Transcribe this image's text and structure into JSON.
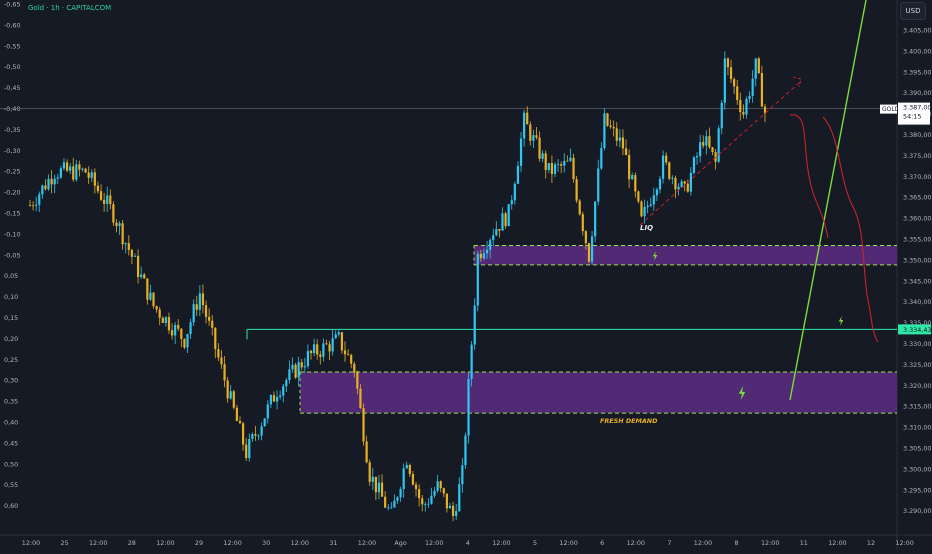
{
  "header": {
    "title": "Gold · 1h · CAPITALCOM",
    "currency": "USD"
  },
  "price_tag": {
    "symbol": "GOLD",
    "price": "3.387,00",
    "countdown": "54:15"
  },
  "level_tag": {
    "value": "3.334,43"
  },
  "annotations": {
    "liq": "LIQ",
    "fresh_demand": "FRESH DEMAND"
  },
  "colors": {
    "background": "#161a25",
    "bull_candle": "#2ec7f2",
    "bear_candle": "#e8b020",
    "demand_zone": "#5c2d83",
    "zone_border": "#9be24a",
    "level_line": "#2ee8a8",
    "projection_green": "#7cdd3a",
    "projection_red": "#d3242c"
  },
  "chart_data": {
    "type": "candlestick",
    "title": "Gold · 1h · CAPITALCOM",
    "currency": "USD",
    "right_axis": {
      "ticks": [
        "3.405,00",
        "3.400,00",
        "3.395,00",
        "3.390,00",
        "3.385,00",
        "3.380,00",
        "3.375,00",
        "3.370,00",
        "3.365,00",
        "3.360,00",
        "3.355,00",
        "3.350,00",
        "3.345,00",
        "3.340,00",
        "3.335,00",
        "3.330,00",
        "3.325,00",
        "3.320,00",
        "3.315,00",
        "3.310,00",
        "3.305,00",
        "3.300,00",
        "3.295,00",
        "3.290,00"
      ],
      "range": [
        3287.5,
        3412.5
      ]
    },
    "left_axis": {
      "ticks": [
        "-0,65",
        "-0,60",
        "-0,55",
        "-0,50",
        "-0,45",
        "-0,40",
        "-0,35",
        "-0,30",
        "-0,25",
        "-0,20",
        "-0,15",
        "-0,10",
        "-0,05",
        "0,05",
        "0,10",
        "0,15",
        "0,20",
        "0,25",
        "0,30",
        "0,35",
        "0,40",
        "0,45",
        "0,50",
        "0,55",
        "0,60"
      ]
    },
    "x_axis": {
      "ticks": [
        "12:00",
        "25",
        "12:00",
        "28",
        "12:00",
        "29",
        "12:00",
        "30",
        "12:00",
        "31",
        "12:00",
        "Ago",
        "12:00",
        "4",
        "12:00",
        "5",
        "12:00",
        "6",
        "12:00",
        "7",
        "12:00",
        "8",
        "12:00",
        "11",
        "12:00",
        "12",
        "12:00"
      ]
    },
    "waypoints": [
      [
        0,
        3364
      ],
      [
        8,
        3372
      ],
      [
        18,
        3372
      ],
      [
        27,
        3362
      ],
      [
        40,
        3340
      ],
      [
        50,
        3332
      ],
      [
        55,
        3343
      ],
      [
        60,
        3330
      ],
      [
        70,
        3305
      ],
      [
        80,
        3320
      ],
      [
        90,
        3328
      ],
      [
        100,
        3332
      ],
      [
        105,
        3325
      ],
      [
        110,
        3300
      ],
      [
        117,
        3290
      ],
      [
        122,
        3304
      ],
      [
        127,
        3292
      ],
      [
        132,
        3297
      ],
      [
        137,
        3290
      ],
      [
        140,
        3300
      ],
      [
        145,
        3352
      ],
      [
        150,
        3358
      ],
      [
        155,
        3362
      ],
      [
        160,
        3384
      ],
      [
        168,
        3372
      ],
      [
        175,
        3374
      ],
      [
        181,
        3352
      ],
      [
        186,
        3384
      ],
      [
        192,
        3378
      ],
      [
        198,
        3360
      ],
      [
        205,
        3374
      ],
      [
        212,
        3367
      ],
      [
        218,
        3380
      ],
      [
        222,
        3374
      ],
      [
        225,
        3398
      ],
      [
        231,
        3386
      ],
      [
        235,
        3397
      ],
      [
        238,
        3386
      ]
    ],
    "current_price": 3387.0,
    "horizontal_level": 3334.43,
    "zones": [
      {
        "label": "FRESH DEMAND",
        "top": 3324.3,
        "bottom": 3314.5
      },
      {
        "label": "",
        "top": 3354.4,
        "bottom": 3349.8
      }
    ],
    "labels": [
      "LIQ",
      "FRESH DEMAND"
    ]
  }
}
